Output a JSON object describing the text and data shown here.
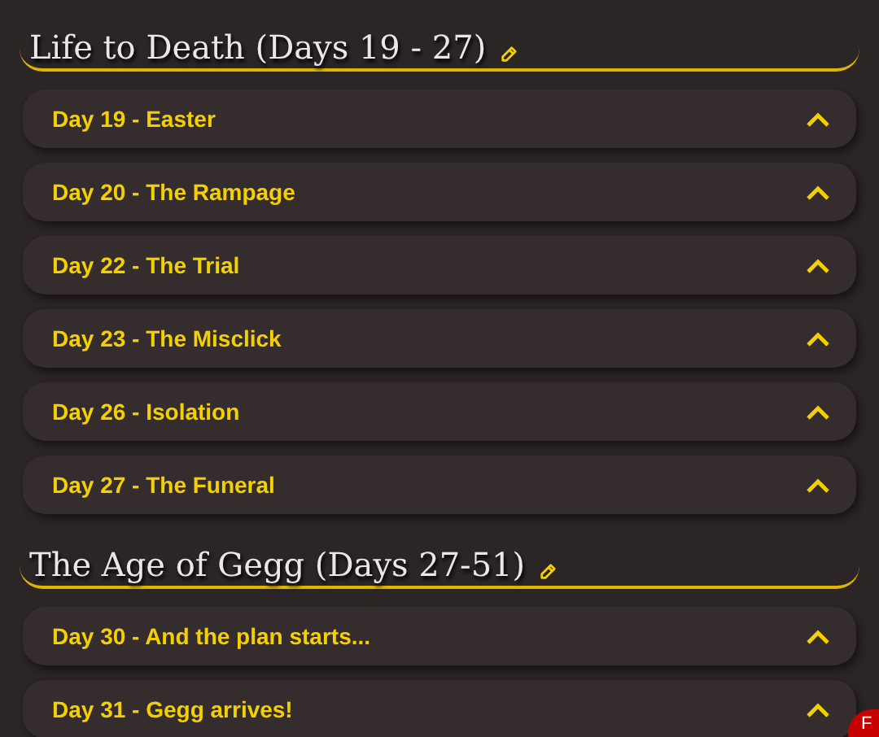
{
  "sections": [
    {
      "title": "Life to Death (Days 19 - 27)",
      "items": [
        {
          "label": "Day 19 - Easter"
        },
        {
          "label": "Day 20 - The Rampage"
        },
        {
          "label": "Day 22 - The Trial"
        },
        {
          "label": "Day 23 - The Misclick"
        },
        {
          "label": "Day 26 - Isolation"
        },
        {
          "label": "Day 27 - The Funeral"
        }
      ]
    },
    {
      "title": "The Age of Gegg (Days 27-51)",
      "items": [
        {
          "label": "Day 30 - And the plan starts..."
        },
        {
          "label": "Day 31 - Gegg arrives!"
        }
      ]
    }
  ],
  "corner_badge": "F"
}
